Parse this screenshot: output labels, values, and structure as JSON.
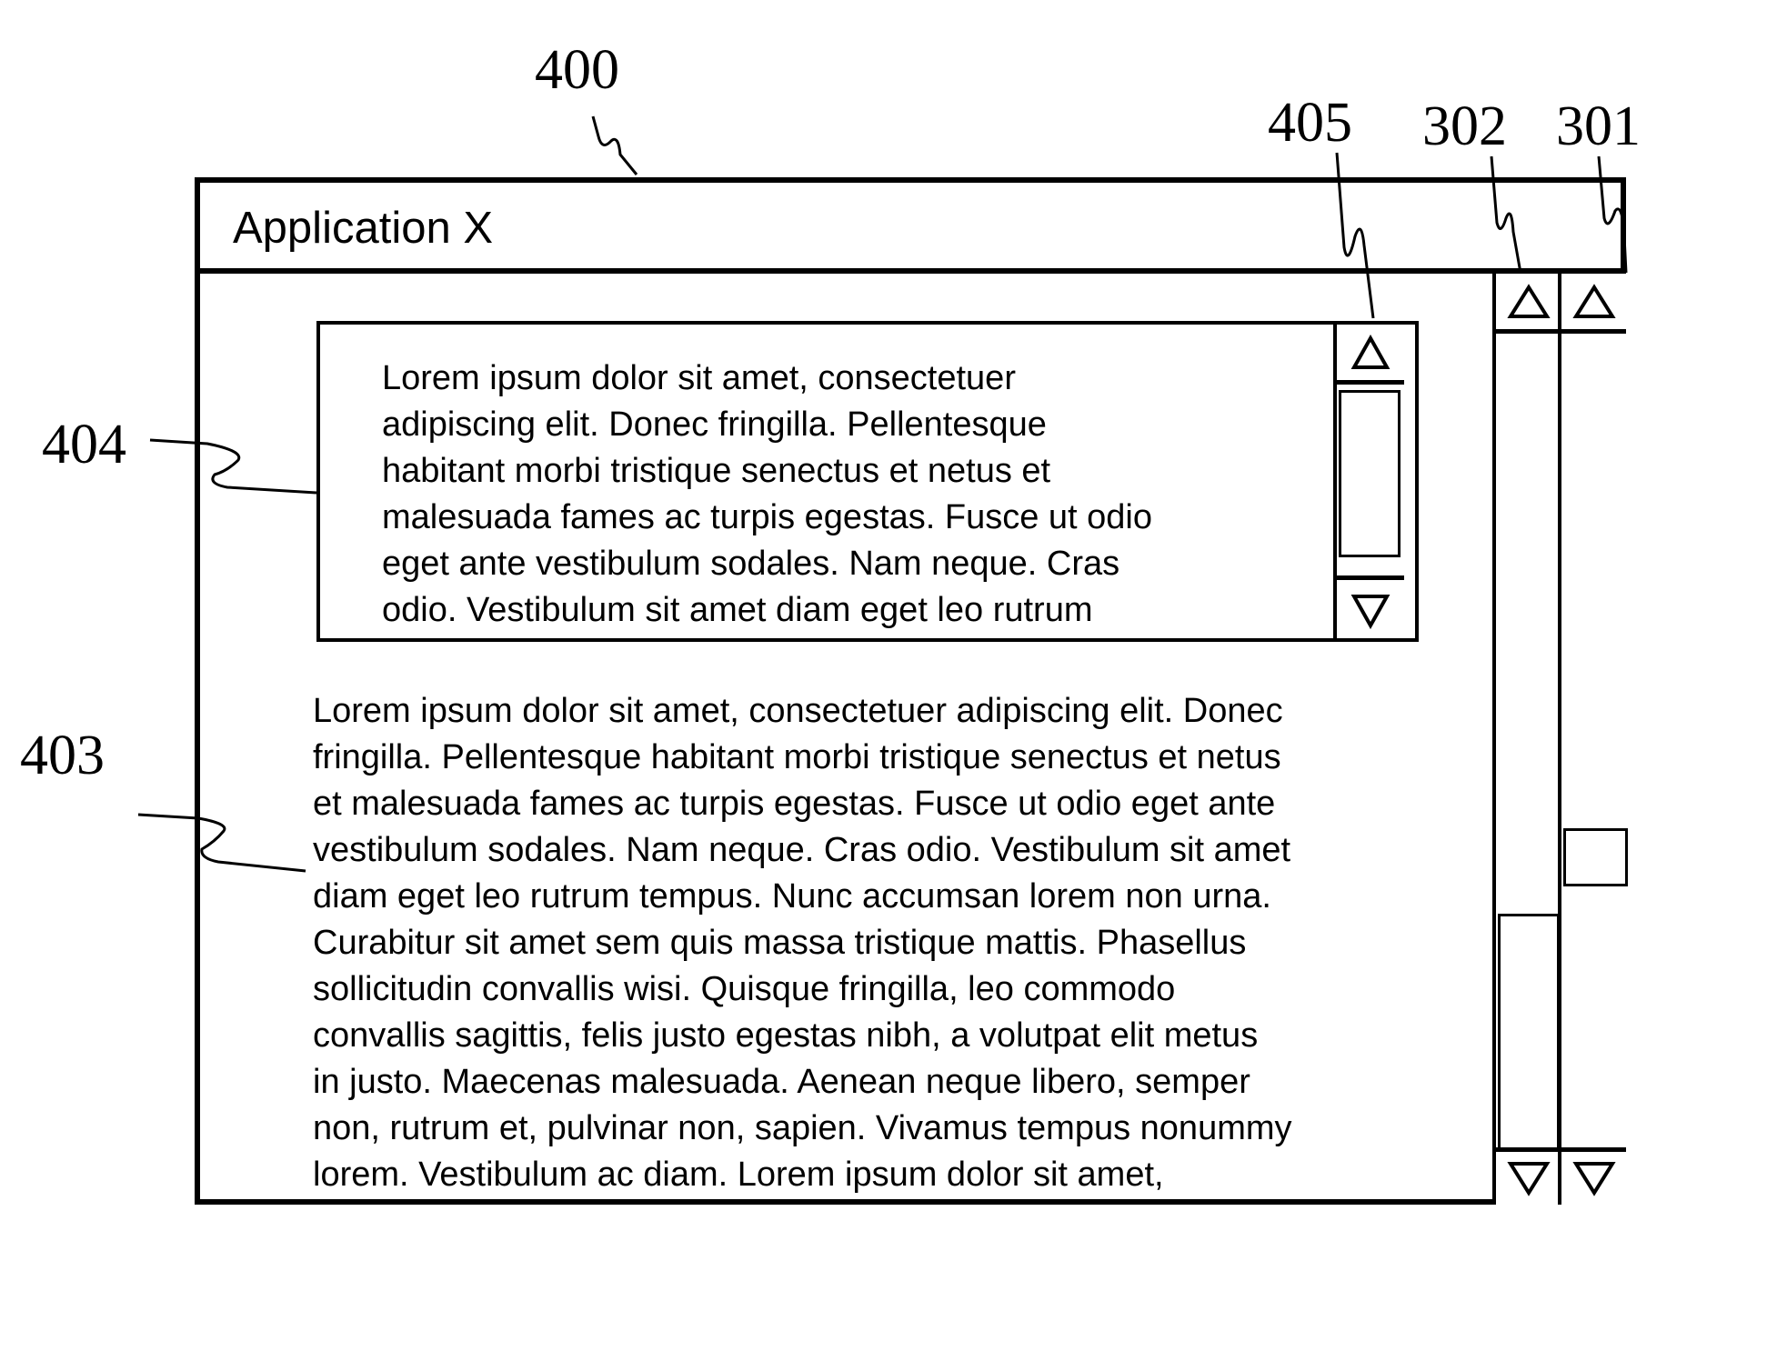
{
  "reference_labels": {
    "window": "400",
    "text_box": "404",
    "text_box_scrollbar": "405",
    "main_text": "403",
    "scrollbar_302": "302",
    "scrollbar_301": "301"
  },
  "window": {
    "title": "Application X"
  },
  "text_box": {
    "text": "Lorem ipsum dolor sit amet, consectetuer\nadipiscing elit. Donec fringilla. Pellentesque\nhabitant morbi tristique senectus et netus et\nmalesuada fames ac turpis egestas. Fusce ut odio\neget ante vestibulum sodales. Nam neque. Cras\nodio. Vestibulum sit amet diam eget leo rutrum\ntempus. Nunc accumsan lorem non urna. Curabitur",
    "scrollbar": {
      "up_icon": "triangle-up",
      "down_icon": "triangle-down",
      "thumb_position": 0.0,
      "thumb_size": 0.74
    }
  },
  "main_text": {
    "text": "Lorem ipsum dolor sit amet, consectetuer adipiscing elit. Donec\nfringilla. Pellentesque habitant morbi tristique senectus et netus\net malesuada fames ac turpis egestas. Fusce ut odio eget ante\nvestibulum sodales. Nam neque. Cras odio. Vestibulum sit amet\ndiam eget leo rutrum tempus. Nunc accumsan lorem non urna.\nCurabitur sit amet sem quis massa tristique mattis. Phasellus\nsollicitudin convallis wisi. Quisque fringilla, leo commodo\nconvallis sagittis, felis justo egestas nibh, a volutpat elit metus\nin justo. Maecenas malesuada. Aenean neque libero, semper\nnon, rutrum et, pulvinar non, sapien. Vivamus tempus nonummy\nlorem. Vestibulum ac diam. Lorem ipsum dolor sit amet,"
  },
  "scrollbars": {
    "scrollbar_302": {
      "up_icon": "triangle-up",
      "down_icon": "triangle-down",
      "thumb_position": 1.0,
      "thumb_size": 0.28
    },
    "scrollbar_301": {
      "up_icon": "triangle-up",
      "down_icon": "triangle-down",
      "thumb_position": 0.6,
      "thumb_size": 0.07
    }
  }
}
